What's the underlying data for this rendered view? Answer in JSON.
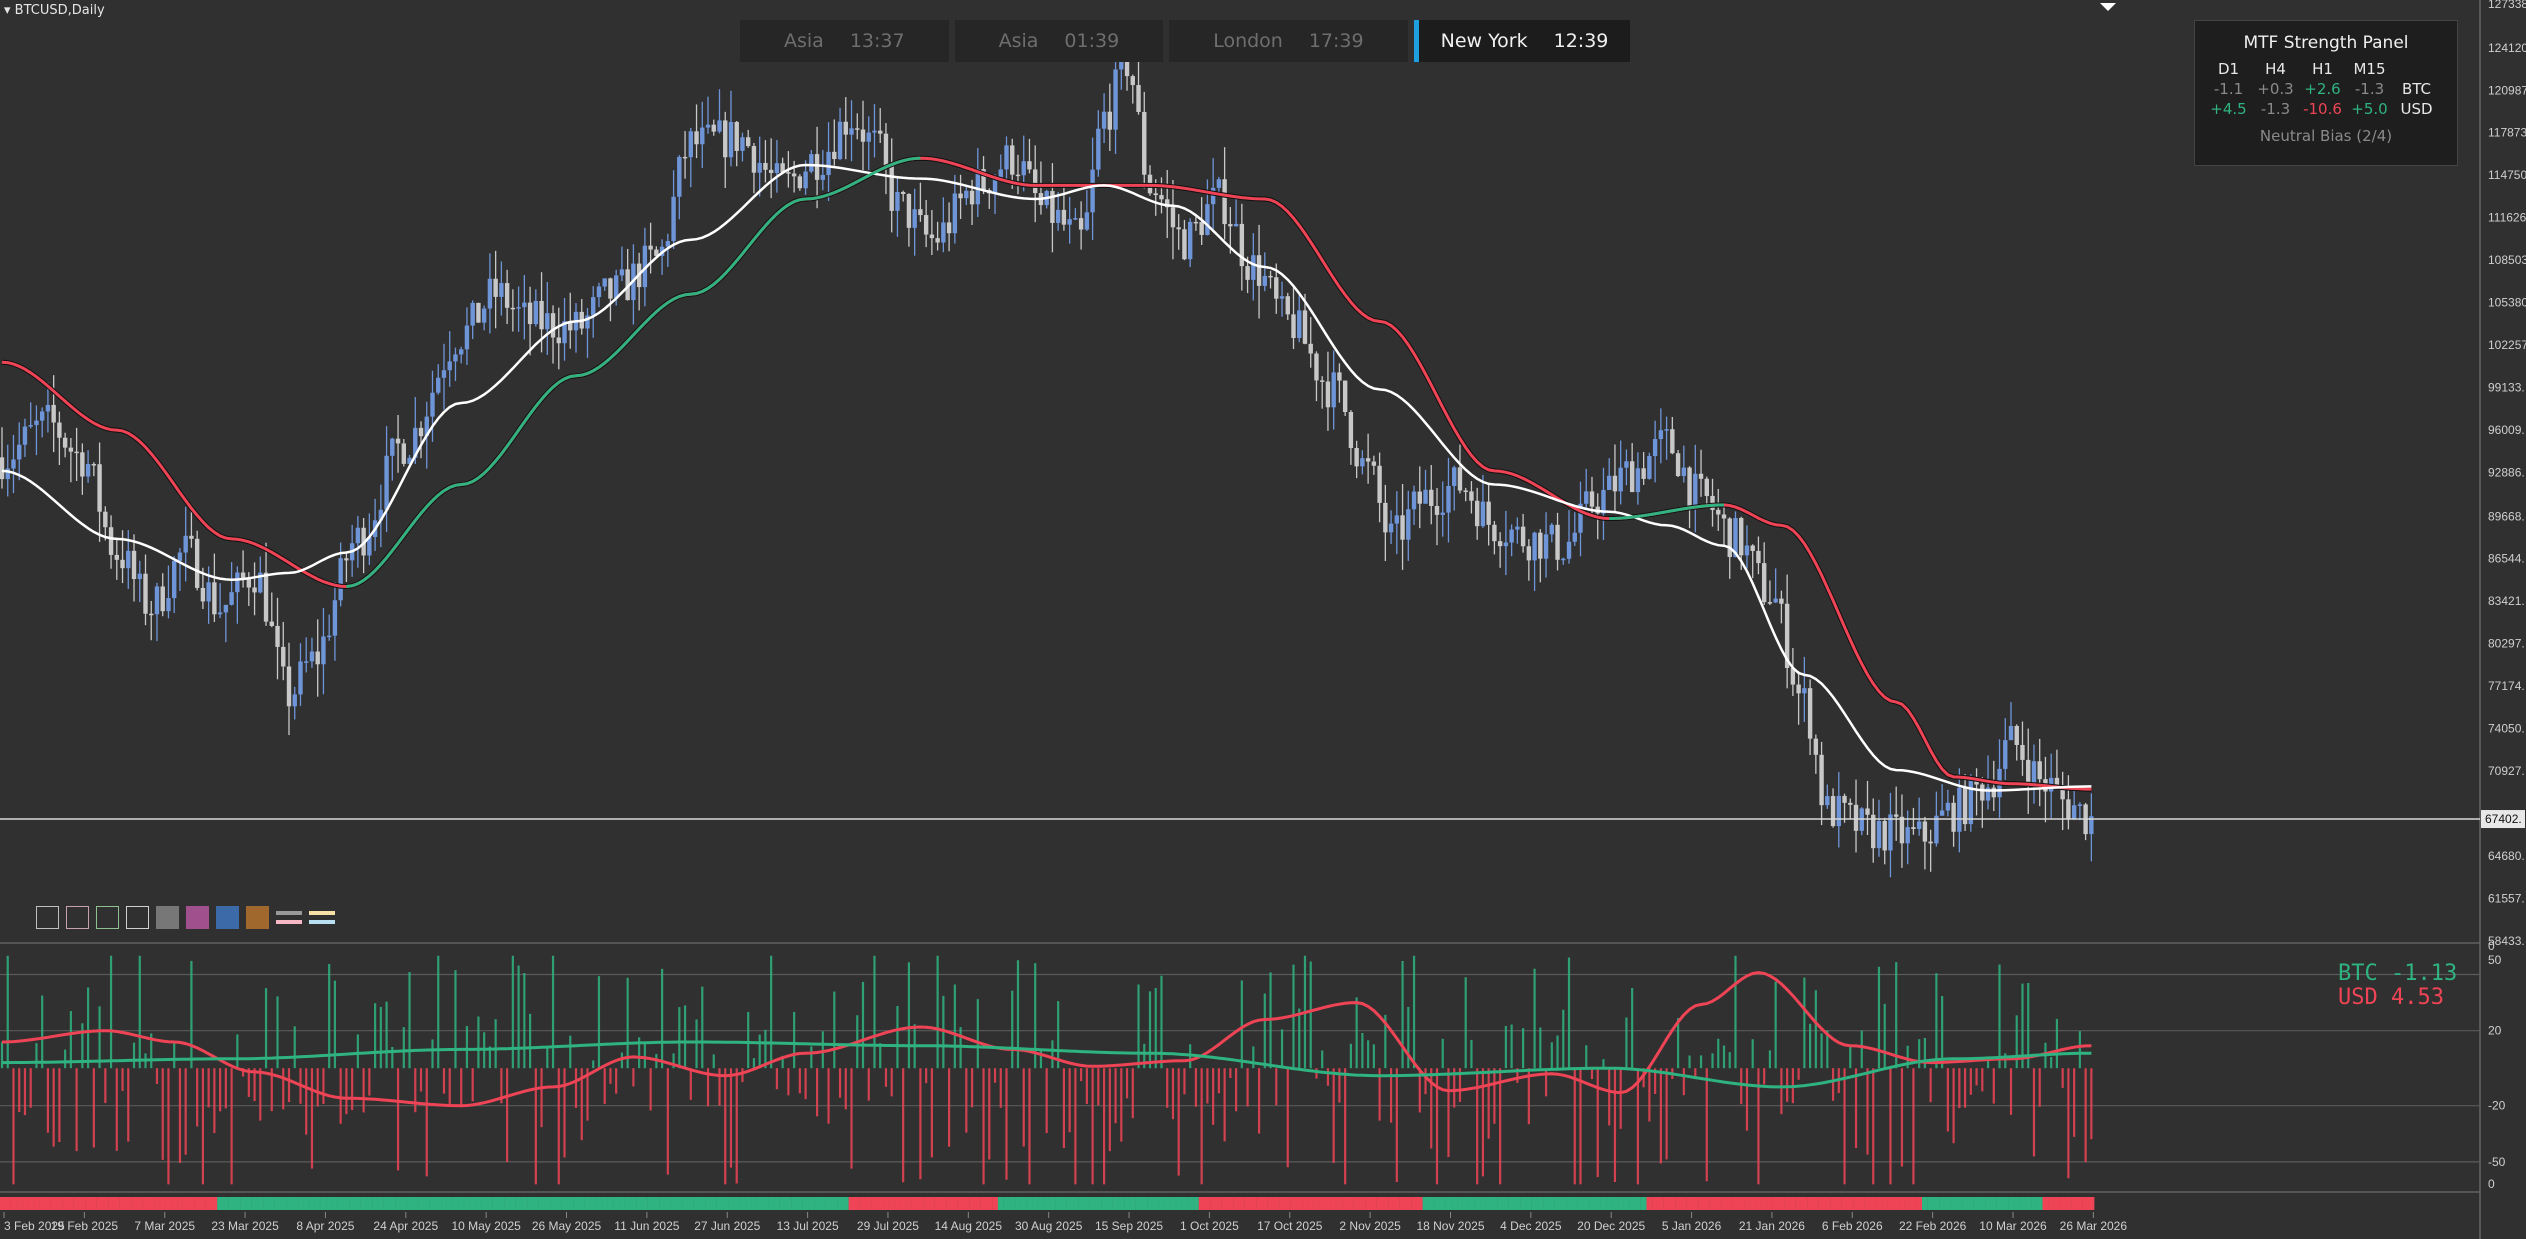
{
  "symbol": "BTCUSD,Daily",
  "sessions": [
    {
      "name": "Asia",
      "time": "13:37",
      "active": false
    },
    {
      "name": "Asia",
      "time": "01:39",
      "active": false
    },
    {
      "name": "London",
      "time": "17:39",
      "active": false
    },
    {
      "name": "New York",
      "time": "12:39",
      "active": true
    }
  ],
  "mtf": {
    "title": "MTF Strength Panel",
    "headers": [
      "D1",
      "H4",
      "H1",
      "M15"
    ],
    "rows": [
      {
        "symbol": "BTC",
        "values": [
          "-1.1",
          "+0.3",
          "+2.6",
          "-1.3"
        ],
        "tones": [
          "neu",
          "neu",
          "pos",
          "neu"
        ]
      },
      {
        "symbol": "USD",
        "values": [
          "+4.5",
          "-1.3",
          "-10.6",
          "+5.0"
        ],
        "tones": [
          "pos",
          "neu",
          "neg",
          "pos"
        ]
      }
    ],
    "bias": "Neutral Bias (2/4)"
  },
  "colors": {
    "background": "#303030",
    "bull": "#6f95d9",
    "bear": "#c8c8c8",
    "ma_fast": "#ffffff",
    "ma_slow_up": "#2fb380",
    "ma_slow_down": "#ee4455",
    "btc": "#2fb380",
    "usd": "#ee4455"
  },
  "swatches": [
    "#2a2a2a",
    "#2a2a2a",
    "#2a2a2a",
    "#2a2a2a",
    "#777777",
    "#a0508c",
    "#3c6aa8",
    "#a0682c"
  ],
  "indicator_legend": {
    "btc": "BTC -1.13",
    "usd": "USD  4.53"
  },
  "chart_data": {
    "type": "candlestick",
    "price_axis_labels": [
      "127338",
      "124120",
      "120987",
      "117873",
      "114750",
      "111626",
      "108503",
      "105380",
      "102257",
      "99133",
      "96009",
      "92886",
      "89668",
      "86544",
      "83421",
      "80297",
      "77174",
      "74050",
      "70927",
      "67402",
      "64680",
      "61557",
      "58433"
    ],
    "current_price_label": "67402",
    "current_price": 67402,
    "ylim": [
      58433,
      127338
    ],
    "x_tick_labels": [
      "3 Feb 2025",
      "19 Feb 2025",
      "7 Mar 2025",
      "23 Mar 2025",
      "8 Apr 2025",
      "24 Apr 2025",
      "10 May 2025",
      "26 May 2025",
      "11 Jun 2025",
      "27 Jun 2025",
      "13 Jul 2025",
      "29 Jul 2025",
      "14 Aug 2025",
      "30 Aug 2025",
      "15 Sep 2025",
      "1 Oct 2025",
      "17 Oct 2025",
      "2 Nov 2025",
      "18 Nov 2025",
      "4 Dec 2025",
      "20 Dec 2025",
      "5 Jan 2026",
      "21 Jan 2026",
      "6 Feb 2026",
      "22 Feb 2026",
      "10 Mar 2026",
      "26 Mar 2026"
    ],
    "price_anchors": [
      [
        0,
        94000
      ],
      [
        8,
        96500
      ],
      [
        14,
        94000
      ],
      [
        20,
        87000
      ],
      [
        26,
        83000
      ],
      [
        32,
        87000
      ],
      [
        38,
        83000
      ],
      [
        44,
        85500
      ],
      [
        50,
        76500
      ],
      [
        54,
        79000
      ],
      [
        62,
        88000
      ],
      [
        70,
        95000
      ],
      [
        80,
        103000
      ],
      [
        86,
        106000
      ],
      [
        92,
        104000
      ],
      [
        100,
        103500
      ],
      [
        106,
        106000
      ],
      [
        114,
        108500
      ],
      [
        120,
        117000
      ],
      [
        128,
        117500
      ],
      [
        136,
        114000
      ],
      [
        142,
        116000
      ],
      [
        148,
        119000
      ],
      [
        152,
        117000
      ],
      [
        156,
        112500
      ],
      [
        162,
        110000
      ],
      [
        170,
        114000
      ],
      [
        176,
        116000
      ],
      [
        182,
        112000
      ],
      [
        188,
        110000
      ],
      [
        192,
        119000
      ],
      [
        196,
        123000
      ],
      [
        200,
        114000
      ],
      [
        206,
        110000
      ],
      [
        212,
        113000
      ],
      [
        218,
        108000
      ],
      [
        224,
        104000
      ],
      [
        232,
        99000
      ],
      [
        238,
        93000
      ],
      [
        242,
        88000
      ],
      [
        248,
        91000
      ],
      [
        254,
        92000
      ],
      [
        260,
        89000
      ],
      [
        266,
        88000
      ],
      [
        272,
        87500
      ],
      [
        278,
        91000
      ],
      [
        284,
        93000
      ],
      [
        290,
        95000
      ],
      [
        296,
        91000
      ],
      [
        302,
        88000
      ],
      [
        308,
        84000
      ],
      [
        314,
        76000
      ],
      [
        318,
        68000
      ],
      [
        326,
        66500
      ],
      [
        334,
        66000
      ],
      [
        340,
        68000
      ],
      [
        346,
        70000
      ],
      [
        350,
        73000
      ],
      [
        356,
        70000
      ],
      [
        360,
        68500
      ],
      [
        364,
        67402
      ]
    ],
    "ma_fast_anchors": [
      [
        0,
        93000
      ],
      [
        20,
        88000
      ],
      [
        40,
        85000
      ],
      [
        50,
        85500
      ],
      [
        60,
        87000
      ],
      [
        80,
        98000
      ],
      [
        100,
        104000
      ],
      [
        120,
        110000
      ],
      [
        140,
        115500
      ],
      [
        160,
        114500
      ],
      [
        180,
        113000
      ],
      [
        192,
        114000
      ],
      [
        204,
        112500
      ],
      [
        220,
        108000
      ],
      [
        240,
        99000
      ],
      [
        260,
        92000
      ],
      [
        280,
        90000
      ],
      [
        290,
        89000
      ],
      [
        300,
        87500
      ],
      [
        314,
        78000
      ],
      [
        330,
        71000
      ],
      [
        346,
        69500
      ],
      [
        364,
        69800
      ]
    ],
    "ma_slow_anchors": [
      [
        0,
        101000
      ],
      [
        20,
        96000
      ],
      [
        40,
        88000
      ],
      [
        60,
        84500
      ],
      [
        80,
        92000
      ],
      [
        100,
        100000
      ],
      [
        120,
        106000
      ],
      [
        140,
        113000
      ],
      [
        160,
        116000
      ],
      [
        180,
        114000
      ],
      [
        200,
        114000
      ],
      [
        220,
        113000
      ],
      [
        240,
        104000
      ],
      [
        260,
        93000
      ],
      [
        280,
        89500
      ],
      [
        300,
        90500
      ],
      [
        310,
        89000
      ],
      [
        330,
        76000
      ],
      [
        340,
        70500
      ],
      [
        350,
        70000
      ],
      [
        364,
        69600
      ]
    ],
    "indicator": {
      "levels": [
        50,
        20,
        -20,
        -50
      ],
      "axis_labels": [
        "50",
        "20",
        "-20",
        "-50",
        "0"
      ],
      "ylim": [
        -65,
        62
      ],
      "btc_value": -1.13,
      "usd_value": 4.53,
      "usd_anchors": [
        [
          0,
          14
        ],
        [
          18,
          20
        ],
        [
          30,
          14
        ],
        [
          44,
          -2
        ],
        [
          60,
          -16
        ],
        [
          80,
          -20
        ],
        [
          96,
          -10
        ],
        [
          110,
          6
        ],
        [
          126,
          -4
        ],
        [
          140,
          8
        ],
        [
          160,
          22
        ],
        [
          176,
          10
        ],
        [
          190,
          1
        ],
        [
          206,
          4
        ],
        [
          220,
          26
        ],
        [
          236,
          35
        ],
        [
          252,
          -12
        ],
        [
          270,
          -3
        ],
        [
          282,
          -13
        ],
        [
          296,
          34
        ],
        [
          306,
          51
        ],
        [
          322,
          12
        ],
        [
          336,
          3
        ],
        [
          350,
          5
        ],
        [
          364,
          12
        ]
      ],
      "btc_anchors": [
        [
          0,
          3
        ],
        [
          40,
          5
        ],
        [
          80,
          10
        ],
        [
          120,
          14
        ],
        [
          160,
          12
        ],
        [
          200,
          8
        ],
        [
          240,
          -4
        ],
        [
          280,
          0
        ],
        [
          310,
          -10
        ],
        [
          340,
          5
        ],
        [
          364,
          8
        ]
      ]
    }
  }
}
